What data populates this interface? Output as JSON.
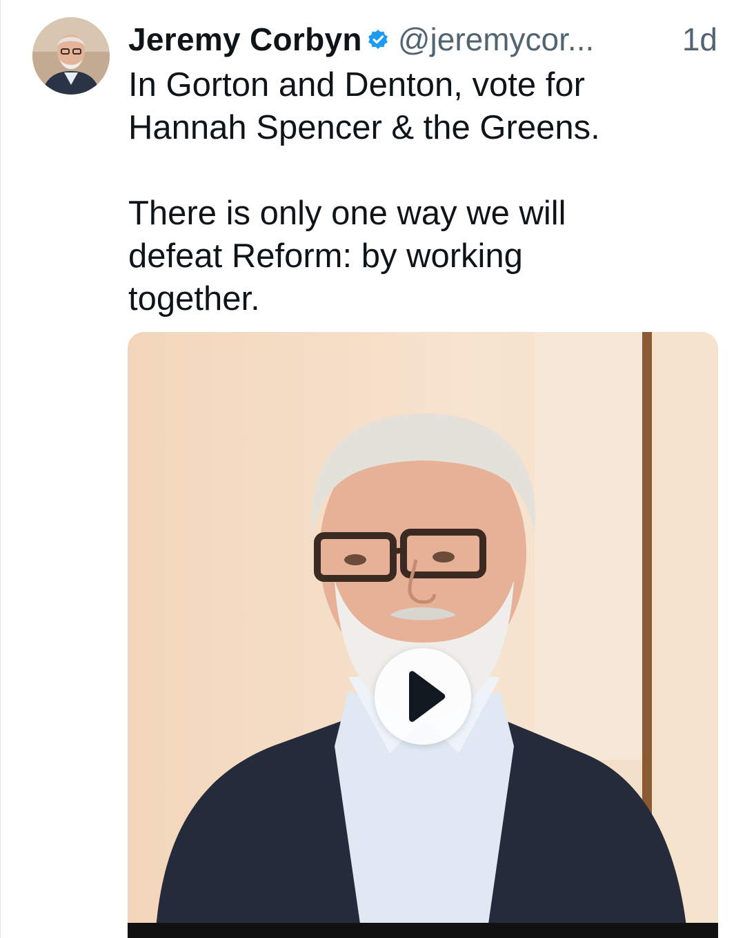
{
  "post": {
    "author_name": "Jeremy Corbyn",
    "handle": "@jeremycor...",
    "time": "1d",
    "text": "In Gorton and Denton, vote for\nHannah Spencer & the Greens.\n\nThere is only one way we will\ndefeat Reform: by working\ntogether."
  },
  "icons": {
    "verified": "verified-badge-icon",
    "play": "play-icon"
  },
  "colors": {
    "verified_blue": "#1d9bf0",
    "text_primary": "#0f1419",
    "text_secondary": "#536471"
  }
}
